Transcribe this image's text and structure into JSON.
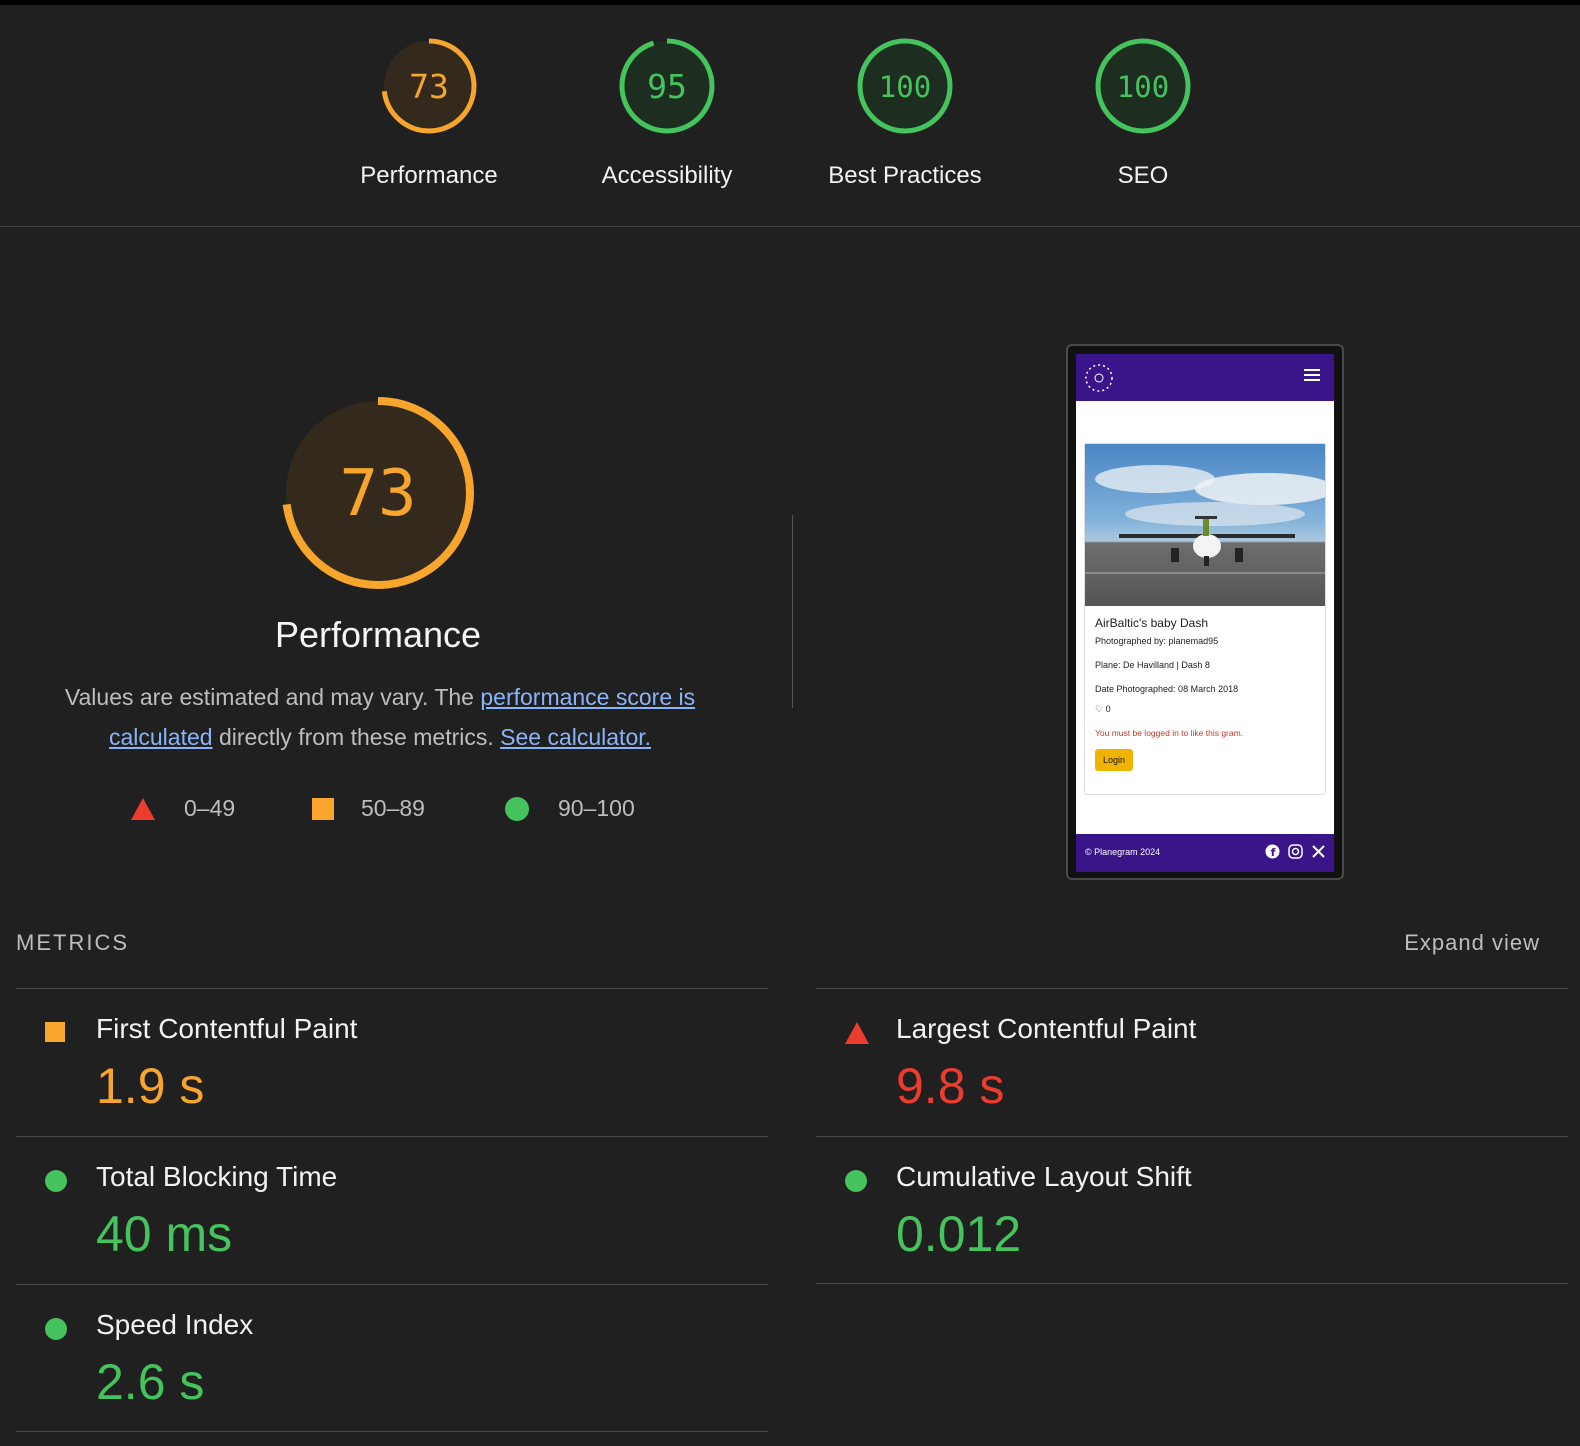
{
  "colors": {
    "orange": "#f7a52d",
    "green": "#45c35c",
    "red": "#ec3c2d",
    "link": "#8ab4f8"
  },
  "summary": [
    {
      "score": "73",
      "fraction": 0.73,
      "label": "Performance",
      "status": "average"
    },
    {
      "score": "95",
      "fraction": 0.95,
      "label": "Accessibility",
      "status": "pass"
    },
    {
      "score": "100",
      "fraction": 1.0,
      "label": "Best Practices",
      "status": "pass"
    },
    {
      "score": "100",
      "fraction": 1.0,
      "label": "SEO",
      "status": "pass"
    }
  ],
  "performance": {
    "score": "73",
    "fraction": 0.73,
    "title": "Performance",
    "desc_prefix": "Values are estimated and may vary. The",
    "link_score": "performance score is calculated",
    "desc_middle": "directly from these metrics.",
    "link_calculator": "See calculator."
  },
  "legend": [
    {
      "icon": "triangle-icon",
      "range": "0–49"
    },
    {
      "icon": "square-icon",
      "range": "50–89"
    },
    {
      "icon": "circle-icon",
      "range": "90–100"
    }
  ],
  "screenshot": {
    "title": "AirBaltic's baby Dash",
    "photographer": "Photographed by: planemad95",
    "plane": "Plane: De Havilland | Dash 8",
    "date": "Date Photographed: 08 March 2018",
    "likes": "0",
    "warning": "You must be logged in to like this gram.",
    "login": "Login",
    "footer": "© Planegram 2024"
  },
  "metrics_header": {
    "label": "METRICS",
    "expand": "Expand view"
  },
  "metrics": [
    {
      "name": "First Contentful Paint",
      "value": "1.9 s",
      "status": "average"
    },
    {
      "name": "Largest Contentful Paint",
      "value": "9.8 s",
      "status": "fail"
    },
    {
      "name": "Total Blocking Time",
      "value": "40 ms",
      "status": "pass"
    },
    {
      "name": "Cumulative Layout Shift",
      "value": "0.012",
      "status": "pass"
    },
    {
      "name": "Speed Index",
      "value": "2.6 s",
      "status": "pass"
    }
  ]
}
